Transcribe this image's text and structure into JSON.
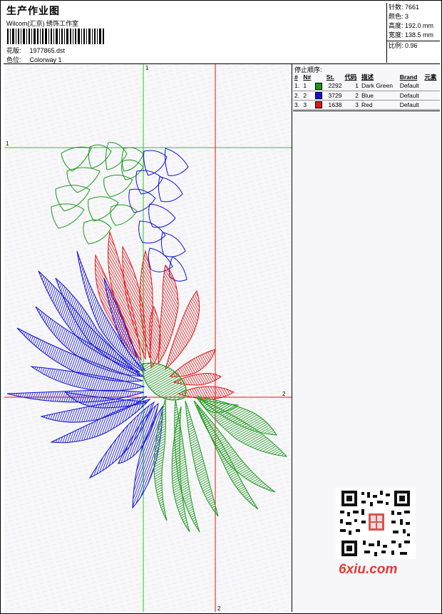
{
  "header": {
    "title": "生产作业图",
    "studio": "Wilcom(汇京) 绣饰工作室",
    "design_label": "花版:",
    "design_value": "1977865.dst",
    "colorway_label": "色位:",
    "colorway_value": "Colorway 1"
  },
  "stats": [
    {
      "label": "针数:",
      "value": "7661"
    },
    {
      "label": "颜色:",
      "value": "3"
    },
    {
      "label": "高度:",
      "value": "192.0 mm"
    },
    {
      "label": "宽度:",
      "value": "138.5 mm"
    },
    {
      "label": "比例:",
      "value": "0.96"
    }
  ],
  "sequence": {
    "title": "停止顺序:",
    "columns": [
      "#",
      "N#",
      "St.",
      "代码",
      "描述",
      "Brand",
      "元素"
    ],
    "rows": [
      {
        "index": "1.",
        "n": "1",
        "color": "#1a9a1a",
        "stitches": "2292",
        "code": "1",
        "description": "Dark Green",
        "brand": "Default",
        "element": ""
      },
      {
        "index": "2.",
        "n": "2",
        "color": "#1010d8",
        "stitches": "3729",
        "code": "2",
        "description": "Blue",
        "brand": "Default",
        "element": ""
      },
      {
        "index": "3.",
        "n": "3",
        "color": "#e31515",
        "stitches": "1638",
        "code": "3",
        "description": "Red",
        "brand": "Default",
        "element": ""
      }
    ]
  },
  "axes": {
    "green_label_top": "1",
    "green_label_left": "1",
    "red_label_right": "2",
    "red_label_bottom": "2"
  },
  "colors": {
    "green": "#1a9a1a",
    "blue": "#1010d8",
    "red": "#e31515"
  },
  "watermark": "6xiu.com"
}
